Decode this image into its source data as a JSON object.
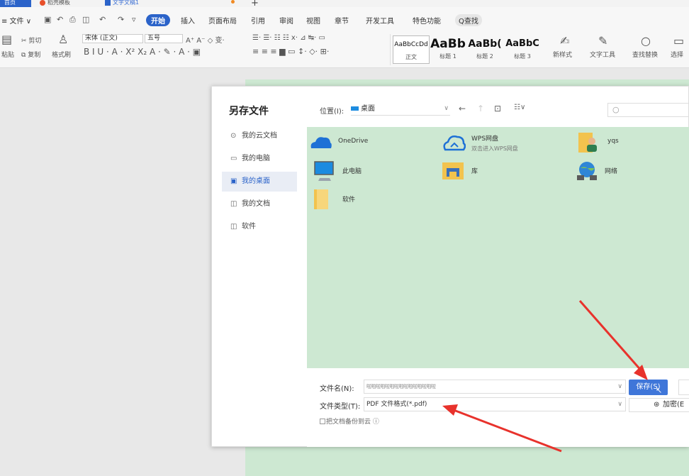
{
  "tabs": {
    "home": "首页",
    "template": "稻壳模板",
    "doc": "文字文稿1"
  },
  "menu": [
    "≡ 文件 ∨",
    "开始",
    "插入",
    "页面布局",
    "引用",
    "审阅",
    "视图",
    "章节",
    "开发工具",
    "特色功能",
    "Q查找"
  ],
  "ribbon": {
    "paste": "粘贴",
    "cut": "剪切",
    "copy": "复制",
    "format_painter": "格式刷",
    "font_name": "宋体 (正文)",
    "font_size": "五号",
    "styles": [
      {
        "sample": "AaBbCcDd",
        "label": "正文"
      },
      {
        "sample": "AaBb",
        "label": "标题 1"
      },
      {
        "sample": "AaBb(",
        "label": "标题 2"
      },
      {
        "sample": "AaBbC",
        "label": "标题 3"
      }
    ],
    "new_style": "新样式",
    "text_tool": "文字工具",
    "find_replace": "查找替换",
    "select": "选择"
  },
  "dialog": {
    "title": "另存文件",
    "sidebar": [
      "我的云文档",
      "我的电脑",
      "我的桌面",
      "我的文档",
      "软件"
    ],
    "location_label": "位置(I):",
    "location_value": "桌面",
    "files": [
      {
        "name": "OneDrive",
        "sub": ""
      },
      {
        "name": "WPS网盘",
        "sub": "双击进入WPS网盘"
      },
      {
        "name": "yqs",
        "sub": ""
      },
      {
        "name": "此电脑",
        "sub": ""
      },
      {
        "name": "库",
        "sub": ""
      },
      {
        "name": "网络",
        "sub": ""
      },
      {
        "name": "软件",
        "sub": ""
      }
    ],
    "filename_label": "文件名(N):",
    "filename_value": "啦啦啦啦啦啦啦啦啦啦啦啦啦啦啦",
    "filetype_label": "文件类型(T):",
    "filetype_value": "PDF 文件格式(*.pdf)",
    "backup_label": "把文档备份到云 ⓘ",
    "save_button": "保存(S)",
    "encrypt_button": "加密(E"
  },
  "colors": {
    "accent": "#2b63c9",
    "save": "#3f76d9",
    "canvas": "#cde8d2",
    "arrow": "#e8322c"
  }
}
